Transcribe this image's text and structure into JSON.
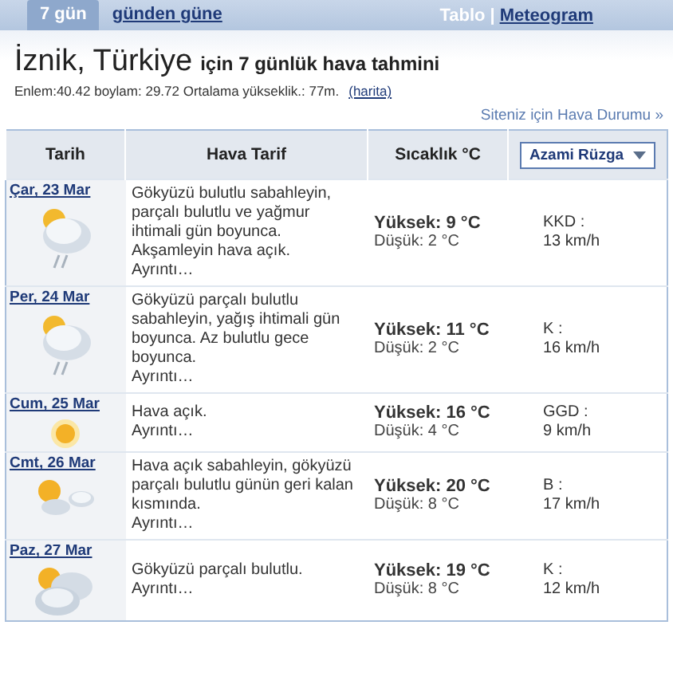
{
  "tabs": [
    {
      "label": "7 gün",
      "selected": true
    },
    {
      "label": "günden güne",
      "selected": false
    }
  ],
  "view_separator": "|",
  "view_links": [
    {
      "label": "Tablo",
      "selected": true
    },
    {
      "label": "Meteogram",
      "selected": false
    }
  ],
  "heading": {
    "place": "İznik, Türkiye",
    "suffix": "için 7 günlük hava tahmini"
  },
  "meta": {
    "text": "Enlem:40.42 boylam: 29.72 Ortalama yükseklik.: 77m.",
    "map_link": "(harita)"
  },
  "site_link": "Siteniz için Hava Durumu »",
  "table": {
    "columns": [
      "Tarih",
      "Hava Tarif",
      "Sıcaklık °C"
    ],
    "wind_select": "Azami Rüzga",
    "rows": [
      {
        "date": "Çar, 23 Mar",
        "kind": "rain",
        "description": "Gökyüzü bulutlu sabahleyin, parçalı bulutlu ve yağmur ihtimali gün boyunca. Akşamleyin hava açık.",
        "details": "Ayrıntı…",
        "high": "Yüksek: 9 °C",
        "low": "Düşük: 2 °C",
        "wind_dir": "KKD :",
        "wind_speed": "13 km/h"
      },
      {
        "date": "Per, 24 Mar",
        "kind": "rain",
        "description": "Gökyüzü parçalı bulutlu sabahleyin, yağış ihtimali gün boyunca. Az bulutlu gece boyunca.",
        "details": "Ayrıntı…",
        "high": "Yüksek: 11 °C",
        "low": "Düşük: 2 °C",
        "wind_dir": "K :",
        "wind_speed": "16 km/h"
      },
      {
        "date": "Cum, 25 Mar",
        "kind": "sun",
        "description": "Hava açık.",
        "details": "Ayrıntı…",
        "high": "Yüksek: 16 °C",
        "low": "Düşük: 4 °C",
        "wind_dir": "GGD :",
        "wind_speed": "9 km/h"
      },
      {
        "date": "Cmt, 26 Mar",
        "kind": "partly",
        "description": "Hava açık sabahleyin, gökyüzü parçalı bulutlu günün geri kalan kısmında.",
        "details": "Ayrıntı…",
        "high": "Yüksek: 20 °C",
        "low": "Düşük: 8 °C",
        "wind_dir": "B :",
        "wind_speed": "17 km/h"
      },
      {
        "date": "Paz, 27 Mar",
        "kind": "cloudy",
        "description": "Gökyüzü parçalı bulutlu.",
        "details": "Ayrıntı…",
        "high": "Yüksek: 19 °C",
        "low": "Düşük: 8 °C",
        "wind_dir": "K :",
        "wind_speed": "12 km/h"
      }
    ]
  }
}
